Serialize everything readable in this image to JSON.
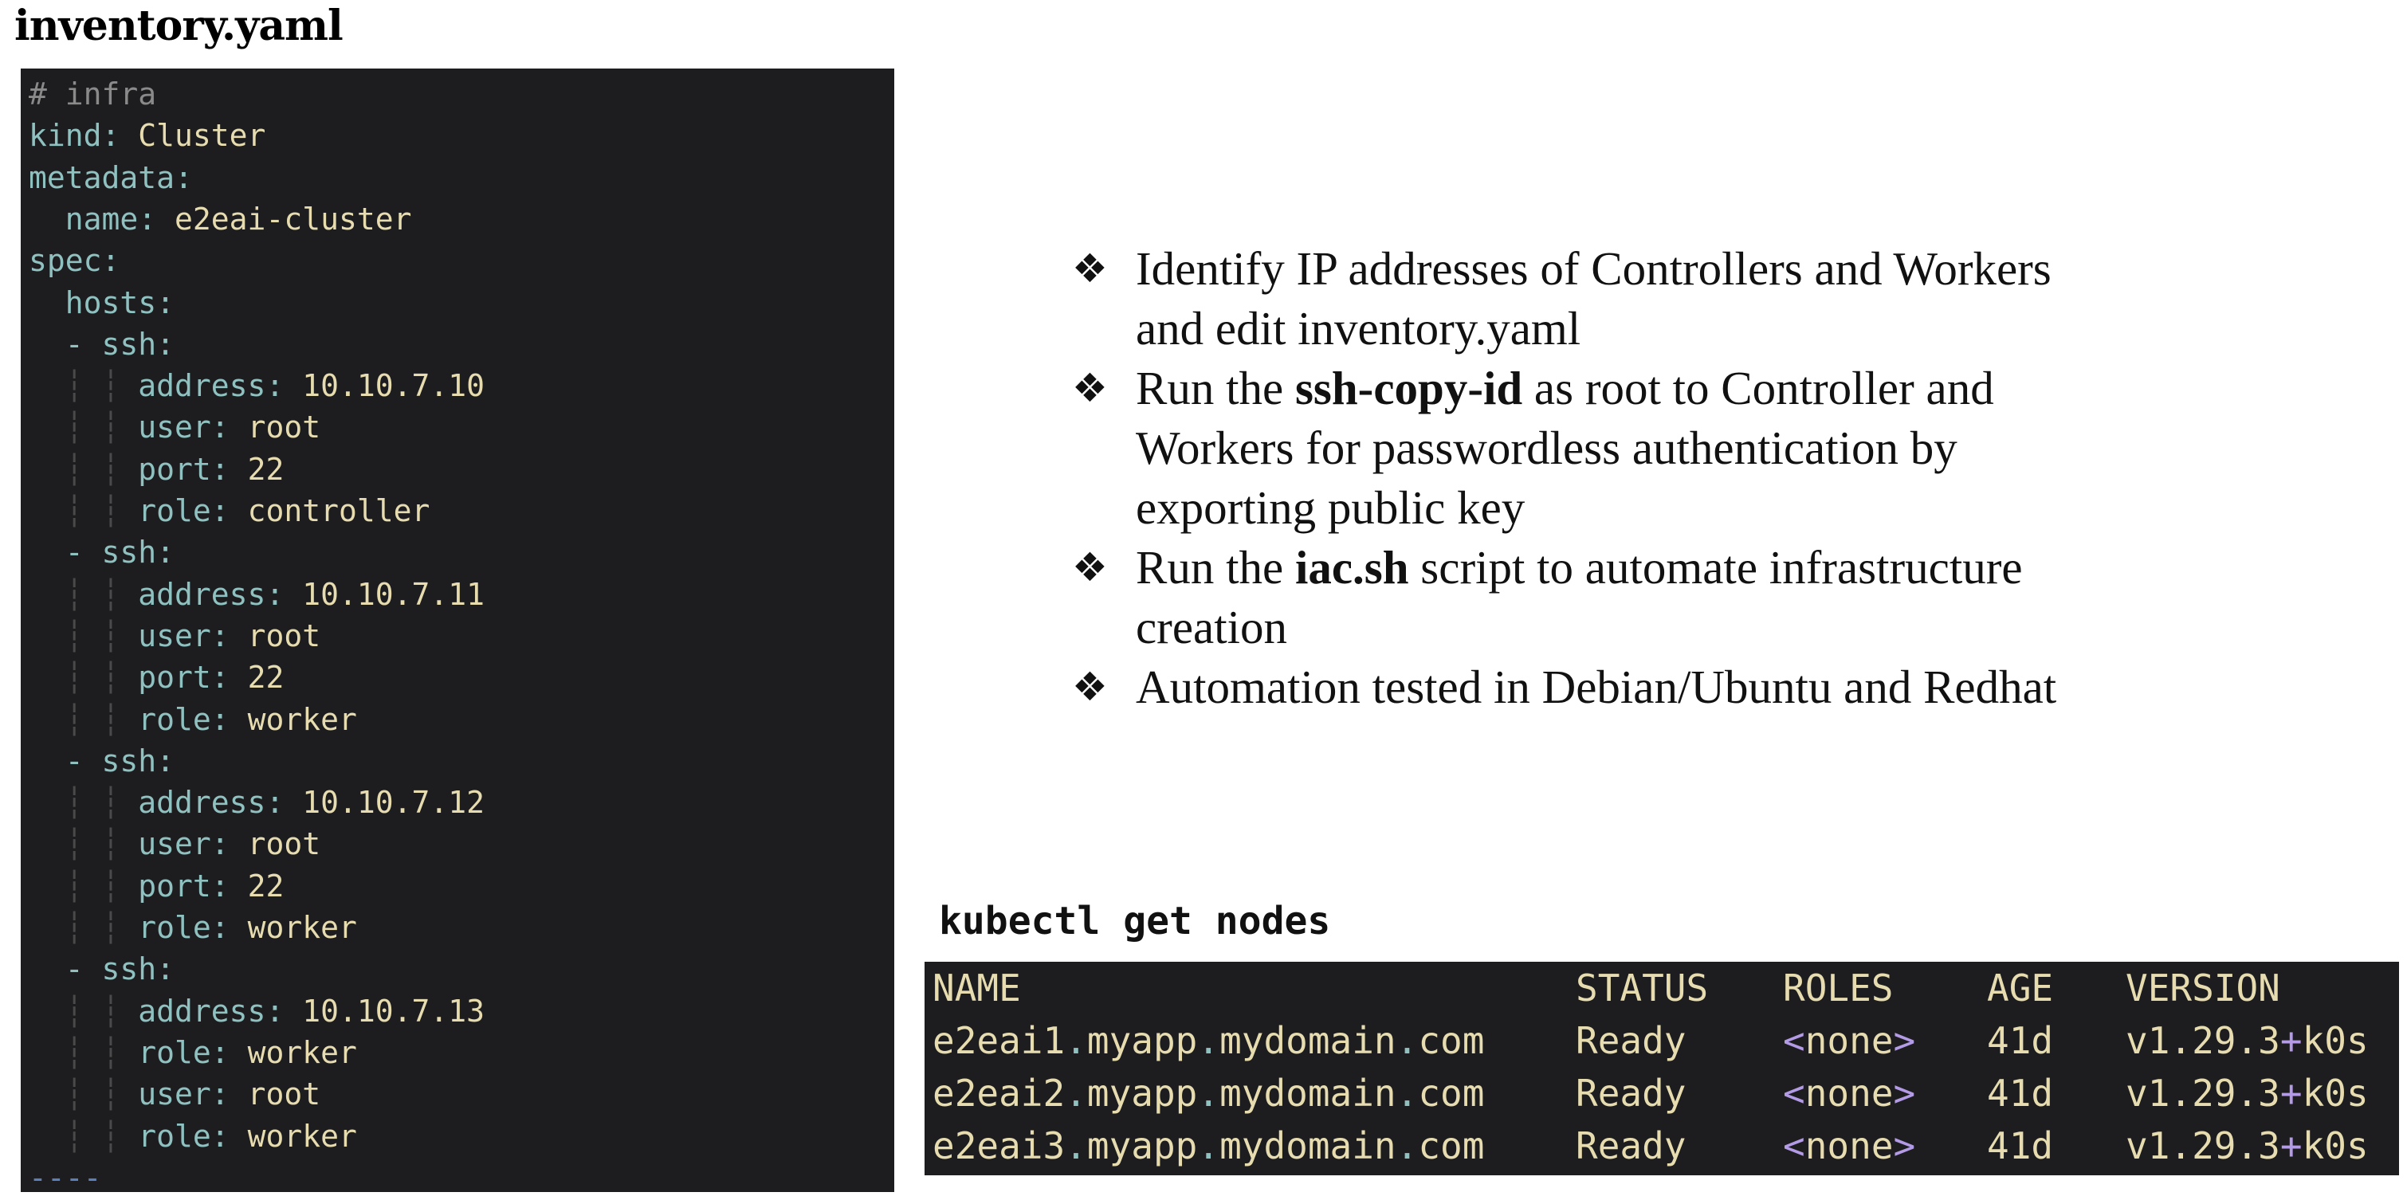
{
  "file_title": "inventory.yaml",
  "yaml_lines": [
    {
      "comment": "# infra"
    },
    {
      "indent": "",
      "key": "kind",
      "value": "Cluster"
    },
    {
      "indent": "",
      "key": "metadata",
      "value": ""
    },
    {
      "indent": "  ",
      "key": "name",
      "value": "e2eai-cluster"
    },
    {
      "indent": "",
      "key": "spec",
      "value": ""
    },
    {
      "indent": "  ",
      "key": "hosts",
      "value": ""
    },
    {
      "indent": "  ",
      "dash": true,
      "key": "ssh",
      "value": ""
    },
    {
      "guide": true,
      "key": "address",
      "value": "10.10.7.10"
    },
    {
      "guide": true,
      "key": "user",
      "value": "root"
    },
    {
      "guide": true,
      "key": "port",
      "value": "22"
    },
    {
      "guide": true,
      "key": "role",
      "value": "controller"
    },
    {
      "indent": "  ",
      "dash": true,
      "key": "ssh",
      "value": ""
    },
    {
      "guide": true,
      "key": "address",
      "value": "10.10.7.11"
    },
    {
      "guide": true,
      "key": "user",
      "value": "root"
    },
    {
      "guide": true,
      "key": "port",
      "value": "22"
    },
    {
      "guide": true,
      "key": "role",
      "value": "worker"
    },
    {
      "indent": "  ",
      "dash": true,
      "key": "ssh",
      "value": ""
    },
    {
      "guide": true,
      "key": "address",
      "value": "10.10.7.12"
    },
    {
      "guide": true,
      "key": "user",
      "value": "root"
    },
    {
      "guide": true,
      "key": "port",
      "value": "22"
    },
    {
      "guide": true,
      "key": "role",
      "value": "worker"
    },
    {
      "indent": "  ",
      "dash": true,
      "key": "ssh",
      "value": ""
    },
    {
      "guide": true,
      "key": "address",
      "value": "10.10.7.13"
    },
    {
      "guide": true,
      "key": "role",
      "value": "worker"
    },
    {
      "guide": true,
      "key": "user",
      "value": "root"
    },
    {
      "guide": true,
      "key": "role",
      "value": "worker"
    },
    {
      "separator": "----"
    }
  ],
  "bullets": [
    {
      "pre": "Identify IP addresses of Controllers and Workers and edit inventory.yaml",
      "bold": "",
      "post": ""
    },
    {
      "pre": "Run the ",
      "bold": "ssh-copy-id",
      "post": " as root to Controller and Workers for passwordless authentication by exporting public key"
    },
    {
      "pre": "Run the ",
      "bold": "iac.sh",
      "post": " script to automate infrastructure creation"
    },
    {
      "pre": "Automation tested in Debian/Ubuntu and Redhat",
      "bold": "",
      "post": ""
    }
  ],
  "bullet_symbol": "❖",
  "command": "kubectl get nodes",
  "kubectl_table": {
    "headers": [
      "NAME",
      "STATUS",
      "ROLES",
      "AGE",
      "VERSION"
    ],
    "rows": [
      {
        "host": "e2eai1",
        "domain_parts": [
          "myapp",
          "mydomain",
          "com"
        ],
        "status": "Ready",
        "roles": "none",
        "age": "41d",
        "version": "v1.29.3",
        "suffix": "k0s"
      },
      {
        "host": "e2eai2",
        "domain_parts": [
          "myapp",
          "mydomain",
          "com"
        ],
        "status": "Ready",
        "roles": "none",
        "age": "41d",
        "version": "v1.29.3",
        "suffix": "k0s"
      },
      {
        "host": "e2eai3",
        "domain_parts": [
          "myapp",
          "mydomain",
          "com"
        ],
        "status": "Ready",
        "roles": "none",
        "age": "41d",
        "version": "v1.29.3",
        "suffix": "k0s"
      }
    ]
  },
  "colors": {
    "panel_bg": "#1d1d1f",
    "yaml_key": "#8fc1c0",
    "yaml_value": "#e6dcb0",
    "accent": "#b49be6"
  }
}
